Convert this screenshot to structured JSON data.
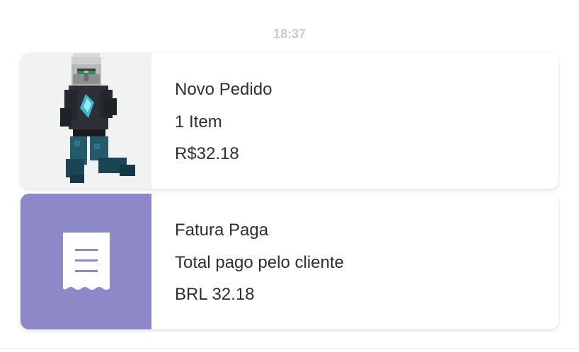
{
  "timestamp": "18:37",
  "order_card": {
    "title": "Novo Pedido",
    "items": "1 Item",
    "price": "R$32.18",
    "thumbnail": "minecraft-illager-character"
  },
  "invoice_card": {
    "title": "Fatura Paga",
    "description": "Total pago pelo cliente",
    "amount": "BRL 32.18",
    "icon": "receipt-icon",
    "accent_color": "#8d89c9"
  }
}
